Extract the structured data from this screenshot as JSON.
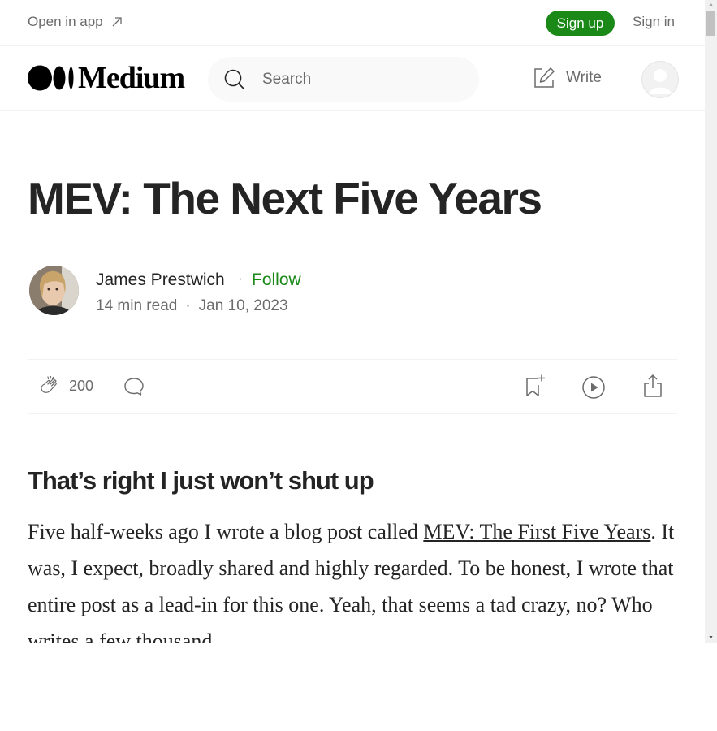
{
  "topbar": {
    "open_in_app": "Open in app",
    "sign_up": "Sign up",
    "sign_in": "Sign in"
  },
  "nav": {
    "logo_text": "Medium",
    "search_placeholder": "Search",
    "write_label": "Write"
  },
  "article": {
    "title": "MEV: The Next Five Years",
    "author": "James Prestwich",
    "separator": "·",
    "follow_label": "Follow",
    "read_time": "14 min read",
    "date": "Jan 10, 2023",
    "clap_count": "200",
    "section_heading": "That’s right I just won’t shut up",
    "paragraph": {
      "part1": "Five half-weeks ago I wrote a blog post called ",
      "link_text": "MEV: The First Five Years",
      "part2": ". It was, I expect, broadly shared and highly regarded. To be honest, I wrote that entire post as a lead-in for this one. Yeah, that seems a tad crazy, no? Who writes a few thousand"
    }
  },
  "colors": {
    "brand_green": "#1a8917",
    "text": "#242424",
    "muted": "#6b6b6b"
  },
  "icons": [
    "external-arrow-icon",
    "medium-logo-icon",
    "search-icon",
    "write-icon",
    "user-avatar-icon",
    "clap-icon",
    "comment-icon",
    "bookmark-icon",
    "play-icon",
    "share-icon"
  ]
}
